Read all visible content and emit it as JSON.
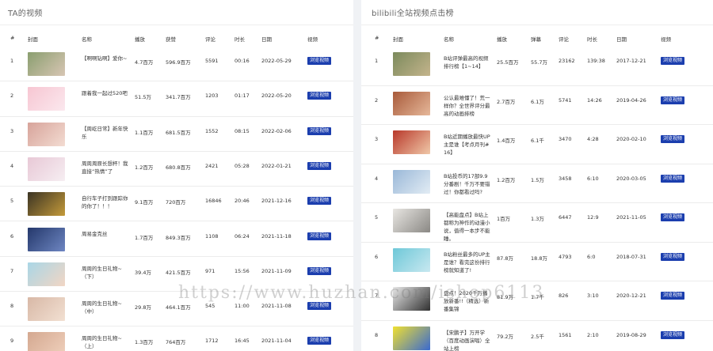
{
  "left": {
    "title": "TA的视频",
    "columns": [
      "#",
      "封面",
      "名称",
      "播放",
      "获赞",
      "评论",
      "时长",
      "日期",
      "视频"
    ],
    "rows": [
      {
        "n": "1",
        "name": "【啊啊钻啊】爱你~",
        "play": "4.7百万",
        "like": "596.9百万",
        "comment": "5591",
        "dur": "00:16",
        "date": "2022-05-29",
        "btn": "浏览视频",
        "c1": "#8a9e6f",
        "c2": "#d8c6b4"
      },
      {
        "n": "2",
        "name": "跟着我一起过520吧",
        "play": "51.5万",
        "like": "341.7百万",
        "comment": "1203",
        "dur": "01:17",
        "date": "2022-05-20",
        "btn": "浏览视频",
        "c1": "#f7c6d2",
        "c2": "#fbe8ee"
      },
      {
        "n": "3",
        "name": "【周屹日常】新年快乐",
        "play": "1.1百万",
        "like": "681.5百万",
        "comment": "1552",
        "dur": "08:15",
        "date": "2022-02-06",
        "btn": "浏览视频",
        "c1": "#d7a39a",
        "c2": "#f3dcd2"
      },
      {
        "n": "4",
        "name": "周周周原长想杯！我直接“热情”了",
        "play": "1.2百万",
        "like": "680.8百万",
        "comment": "2421",
        "dur": "05:28",
        "date": "2022-01-21",
        "btn": "浏览视频",
        "c1": "#e8c8d6",
        "c2": "#f6eef2"
      },
      {
        "n": "5",
        "name": "自行车子打到跟踪你的你了！！！",
        "play": "9.1百万",
        "like": "720百万",
        "comment": "16846",
        "dur": "20:46",
        "date": "2021-12-16",
        "btn": "浏览视频",
        "c1": "#3b3424",
        "c2": "#c49a3a"
      },
      {
        "n": "6",
        "name": "周易金克丝",
        "play": "1.7百万",
        "like": "849.3百万",
        "comment": "1108",
        "dur": "06:24",
        "date": "2021-11-18",
        "btn": "浏览视频",
        "c1": "#24386b",
        "c2": "#6e86c2"
      },
      {
        "n": "7",
        "name": "周周的生日礼物~（下）",
        "play": "39.4万",
        "like": "421.5百万",
        "comment": "971",
        "dur": "15:56",
        "date": "2021-11-09",
        "btn": "浏览视频",
        "c1": "#a9d6e6",
        "c2": "#f2d6c4"
      },
      {
        "n": "8",
        "name": "周周的生日礼物~（中）",
        "play": "29.8万",
        "like": "464.1百万",
        "comment": "545",
        "dur": "11:00",
        "date": "2021-11-08",
        "btn": "浏览视频",
        "c1": "#d8b8a6",
        "c2": "#f2e0d2"
      },
      {
        "n": "9",
        "name": "周周的生日礼物~（上）",
        "play": "1.3百万",
        "like": "764百万",
        "comment": "1712",
        "dur": "16:45",
        "date": "2021-11-04",
        "btn": "浏览视频",
        "c1": "#d4a890",
        "c2": "#efd0bc"
      }
    ]
  },
  "right": {
    "title": "bilibili全站视频点击榜",
    "columns": [
      "#",
      "封面",
      "名称",
      "播放",
      "弹幕",
      "评论",
      "时长",
      "日期",
      "视频"
    ],
    "rows": [
      {
        "n": "1",
        "name": "B站评弹最高的视频排行榜【1~14】",
        "play": "25.5百万",
        "danmu": "55.7万",
        "comment": "23162",
        "dur": "139:38",
        "date": "2017-12-21",
        "btn": "浏览视频",
        "c1": "#7b8a5c",
        "c2": "#c4b48c"
      },
      {
        "n": "2",
        "name": "公认最难懂了！荒一样你？全世界评分最高的动画排榜",
        "play": "2.7百万",
        "danmu": "6.1万",
        "comment": "5741",
        "dur": "14:26",
        "date": "2019-04-26",
        "btn": "浏览视频",
        "c1": "#a85a3a",
        "c2": "#e6b89a"
      },
      {
        "n": "3",
        "name": "B站近期播放最快UP主是谁【考点月刊#16】",
        "play": "1.4百万",
        "danmu": "6.1千",
        "comment": "3470",
        "dur": "4:28",
        "date": "2020-02-10",
        "btn": "浏览视频",
        "c1": "#b8382a",
        "c2": "#f0c8a8"
      },
      {
        "n": "4",
        "name": "B站投币的17部9.9分番剧！千万不要错过！你都看过吗?",
        "play": "1.2百万",
        "danmu": "1.5万",
        "comment": "3458",
        "dur": "6:10",
        "date": "2020-03-05",
        "btn": "浏览视频",
        "c1": "#9ab8d8",
        "c2": "#e2ecf4"
      },
      {
        "n": "5",
        "name": "【高能盘点】B站上都称为神作的动漫小说，值得一本步不能睡。",
        "play": "1百万",
        "danmu": "1.3万",
        "comment": "6447",
        "dur": "12:9",
        "date": "2021-11-05",
        "btn": "浏览视频",
        "c1": "#e8e6e2",
        "c2": "#8a8884"
      },
      {
        "n": "6",
        "name": "B站粉丝最多的UP主是谁？看完这份排行榜就知道了!",
        "play": "87.8万",
        "danmu": "18.8万",
        "comment": "4793",
        "dur": "6:0",
        "date": "2018-07-31",
        "btn": "浏览视频",
        "c1": "#6ec8d8",
        "c2": "#c8e8f0"
      },
      {
        "n": "7",
        "name": "盘点！2020千万播放新番!!（精选）新番集锦",
        "play": "81.9万",
        "danmu": "1.7千",
        "comment": "826",
        "dur": "3:10",
        "date": "2020-12-21",
        "btn": "浏览视频",
        "c1": "#e8e8e8",
        "c2": "#303030"
      },
      {
        "n": "8",
        "name": "【宋鹏子】万开学（百度动画演唱）全站上榜",
        "play": "79.2万",
        "danmu": "2.5千",
        "comment": "1561",
        "dur": "2:10",
        "date": "2019-08-29",
        "btn": "浏览视频",
        "c1": "#f0e030",
        "c2": "#3a6ad0"
      }
    ]
  },
  "watermark": "https://www.huzhan.com/ishop6113"
}
